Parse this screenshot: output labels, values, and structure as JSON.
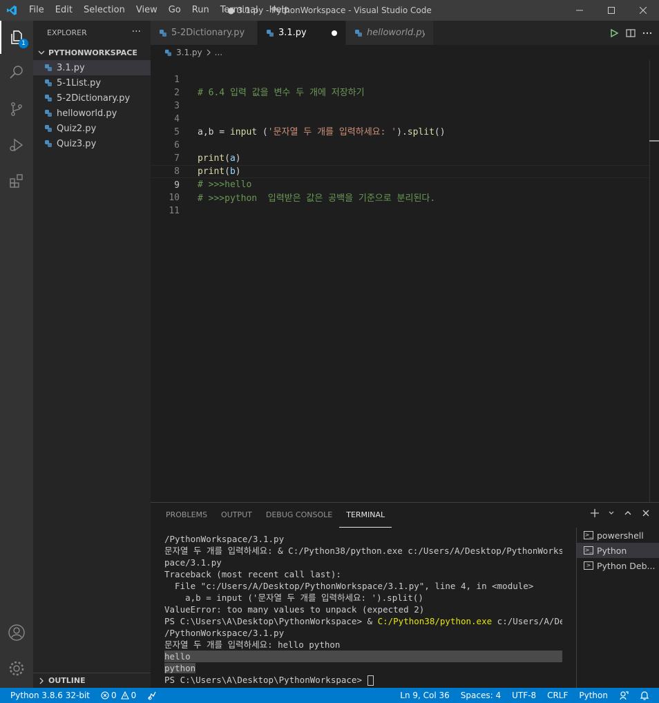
{
  "window": {
    "title": "● 3.1.py - PythonWorkspace - Visual Studio Code",
    "menu": [
      "File",
      "Edit",
      "Selection",
      "View",
      "Go",
      "Run",
      "Terminal",
      "Help"
    ]
  },
  "activity": {
    "explorer_badge": "1"
  },
  "sidebar": {
    "header": "EXPLORER",
    "more": "···",
    "folder": "PYTHONWORKSPACE",
    "files": [
      "3.1.py",
      "5-1List.py",
      "5-2Dictionary.py",
      "helloworld.py",
      "Quiz2.py",
      "Quiz3.py"
    ],
    "outline": "OUTLINE"
  },
  "tabs": [
    {
      "label": "5-2Dictionary.py"
    },
    {
      "label": "3.1.py"
    },
    {
      "label": "helloworld.py"
    }
  ],
  "breadcrumb": {
    "file": "3.1.py",
    "rest": "..."
  },
  "editor": {
    "line_numbers": [
      "1",
      "2",
      "3",
      "4",
      "5",
      "6",
      "7",
      "8",
      "9",
      "10",
      "11"
    ],
    "line1": "# 6.4 입력 값을 변수 두 개에 저장하기",
    "line4_a": "a,b = ",
    "line4_fn": "input",
    "line4_b": " (",
    "line4_str": "'문자열 두 개를 입력하세요: '",
    "line4_c": ").",
    "line4_fn2": "split",
    "line4_d": "()",
    "line6_fn": "print",
    "line6_open": "(",
    "line6_var": "a",
    "line6_close": ")",
    "line7_fn": "print",
    "line7_open": "(",
    "line7_var": "b",
    "line7_close": ")",
    "line8": "# >>>hello",
    "line9": "# >>>python  입력받은 값은 공백을 기준으로 분리된다."
  },
  "panel": {
    "tabs": [
      "PROBLEMS",
      "OUTPUT",
      "DEBUG CONSOLE",
      "TERMINAL"
    ],
    "terminal_lines": [
      "/PythonWorkspace/3.1.py",
      "문자열 두 개를 입력하세요: & C:/Python38/python.exe c:/Users/A/Desktop/PythonWorks",
      "pace/3.1.py",
      "Traceback (most recent call last):",
      "  File \"c:/Users/A/Desktop/PythonWorkspace/3.1.py\", line 4, in <module>",
      "    a,b = input ('문자열 두 개를 입력하세요: ').split()",
      "ValueError: too many values to unpack (expected 2)"
    ],
    "ps_line_prefix": "PS C:\\Users\\A\\Desktop\\PythonWorkspace> & ",
    "ps_line_exe": "C:/Python38/python.exe",
    "ps_line_suffix": " c:/Users/A/Desktop",
    "after_lines": [
      "/PythonWorkspace/3.1.py",
      "문자열 두 개를 입력하세요: hello python"
    ],
    "output_hello": "hello",
    "output_python": "python",
    "prompt": "PS C:\\Users\\A\\Desktop\\PythonWorkspace> ",
    "terminals": [
      "powershell",
      "Python",
      "Python Deb..."
    ]
  },
  "statusbar": {
    "interpreter": "Python 3.8.6 32-bit",
    "errors": "0",
    "warnings": "0",
    "position": "Ln 9, Col 36",
    "spaces": "Spaces: 4",
    "encoding": "UTF-8",
    "eol": "CRLF",
    "language": "Python"
  },
  "colors": {
    "accent": "#007acc",
    "comment": "#6a9955",
    "function": "#dcdcaa",
    "string": "#ce9178",
    "variable": "#9cdcfe"
  }
}
